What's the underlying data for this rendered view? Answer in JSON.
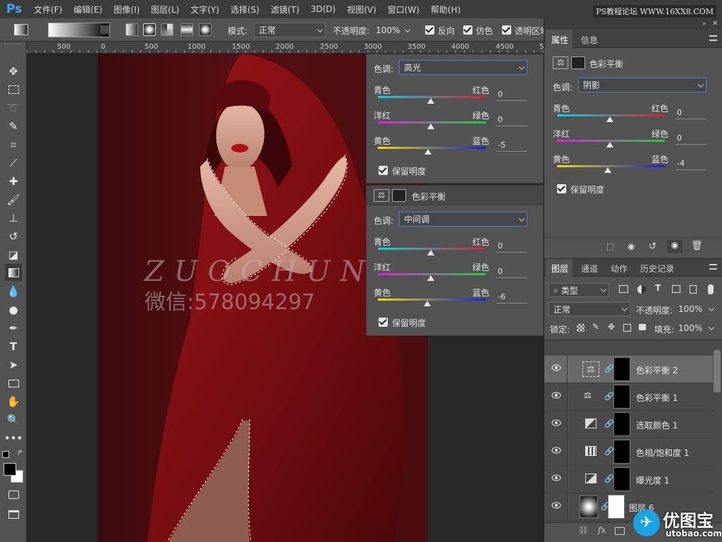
{
  "app": {
    "logo": "Ps"
  },
  "menu": [
    "文件(F)",
    "编辑(E)",
    "图像(I)",
    "图层(L)",
    "文字(Y)",
    "选择(S)",
    "滤镜(T)",
    "3D(D)",
    "视图(V)",
    "窗口(W)",
    "帮助(H)"
  ],
  "watermark_top": "PS教程论坛 WWW.16XX8.COM",
  "options": {
    "mode_label": "模式:",
    "mode_value": "正常",
    "opacity_label": "不透明度:",
    "opacity_value": "100%",
    "reverse": "反向",
    "dither": "仿色",
    "transparency": "透明区域"
  },
  "ruler": [
    "500",
    "0",
    "500",
    "1000",
    "1500",
    "2000",
    "2500",
    "3000",
    "3500",
    "4000",
    "4500",
    "5000"
  ],
  "canvas_watermark": {
    "line1": "ZUOCHUN",
    "line2": "微信:578094297"
  },
  "float_panel_1": {
    "tone_label": "色调:",
    "tone_value": "高光",
    "rows": [
      {
        "left": "青色",
        "right": "红色",
        "value": "0",
        "pos": 0.5
      },
      {
        "left": "洋红",
        "right": "绿色",
        "value": "0",
        "pos": 0.5
      },
      {
        "left": "黄色",
        "right": "蓝色",
        "value": "-5",
        "pos": 0.475
      }
    ],
    "preserve": "保留明度"
  },
  "float_panel_2": {
    "title": "色彩平衡",
    "tone_label": "色调:",
    "tone_value": "中间调",
    "rows": [
      {
        "left": "青色",
        "right": "红色",
        "value": "0",
        "pos": 0.5
      },
      {
        "left": "洋红",
        "right": "绿色",
        "value": "0",
        "pos": 0.5
      },
      {
        "left": "黄色",
        "right": "蓝色",
        "value": "-6",
        "pos": 0.47
      }
    ],
    "preserve": "保留明度"
  },
  "properties": {
    "tabs": [
      "属性",
      "信息"
    ],
    "title": "色彩平衡",
    "tone_label": "色调:",
    "tone_value": "阴影",
    "rows": [
      {
        "left": "青色",
        "right": "红色",
        "value": "0",
        "pos": 0.5
      },
      {
        "left": "洋红",
        "right": "绿色",
        "value": "0",
        "pos": 0.5
      },
      {
        "left": "黄色",
        "right": "蓝色",
        "value": "-4",
        "pos": 0.48
      }
    ],
    "preserve": "保留明度"
  },
  "layers_panel": {
    "tabs": [
      "图层",
      "通道",
      "动作",
      "历史记录"
    ],
    "kind_value": "类型",
    "blend_value": "正常",
    "opacity_label": "不透明度:",
    "opacity_value": "100%",
    "lock_label": "锁定:",
    "fill_label": "填充:",
    "fill_value": "100%",
    "layers": [
      {
        "name": "色彩平衡 2",
        "icon": "balance-icon",
        "selected": true
      },
      {
        "name": "色彩平衡 1",
        "icon": "balance-icon",
        "selected": false
      },
      {
        "name": "选取颜色 1",
        "icon": "selective-color-icon",
        "selected": false
      },
      {
        "name": "色相/饱和度 1",
        "icon": "hue-saturation-icon",
        "selected": false
      },
      {
        "name": "曝光度 1",
        "icon": "exposure-icon",
        "selected": false
      },
      {
        "name": "图层 6",
        "icon": "gradient-thumb",
        "selected": false
      }
    ]
  },
  "brand": {
    "name": "优图宝",
    "url": "utobao.com"
  }
}
